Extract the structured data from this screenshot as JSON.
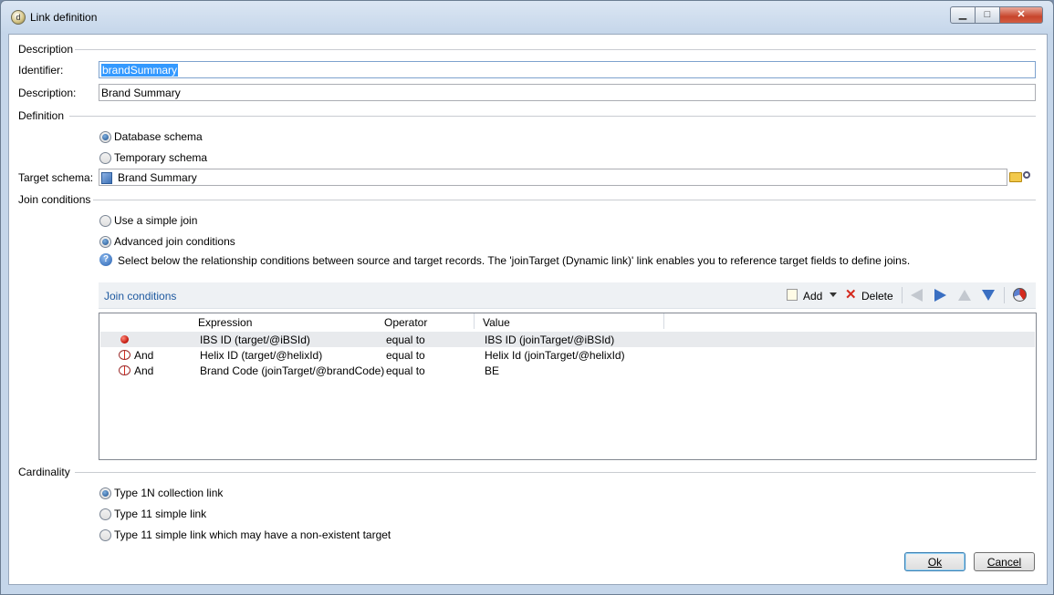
{
  "window": {
    "title": "Link definition",
    "min": "▁",
    "max": "□",
    "close": "✕"
  },
  "description_section": {
    "heading": "Description",
    "identifier_label": "Identifier:",
    "identifier_value": "brandSummary",
    "description_label": "Description:",
    "description_value": "Brand Summary"
  },
  "definition_section": {
    "heading": "Definition",
    "options": [
      {
        "label": "Database schema",
        "selected": true
      },
      {
        "label": "Temporary schema",
        "selected": false
      }
    ],
    "target_schema_label": "Target schema:",
    "target_schema_value": "Brand Summary"
  },
  "join_section": {
    "heading": "Join conditions",
    "options": [
      {
        "label": "Use a simple join",
        "selected": false
      },
      {
        "label": "Advanced join conditions",
        "selected": true
      }
    ],
    "help_text": "Select below the relationship conditions between source and target records. The 'joinTarget (Dynamic link)' link enables you to reference target fields to define joins.",
    "toolbar": {
      "title": "Join conditions",
      "add_label": "Add",
      "delete_label": "Delete"
    },
    "columns": [
      "Expression",
      "Operator",
      "Value"
    ],
    "rows": [
      {
        "conj": "",
        "expression": "IBS ID (target/@iBSId)",
        "operator": "equal to",
        "value": "IBS ID (joinTarget/@iBSId)"
      },
      {
        "conj": "And",
        "expression": "Helix ID (target/@helixId)",
        "operator": "equal to",
        "value": "Helix Id (joinTarget/@helixId)"
      },
      {
        "conj": "And",
        "expression": "Brand Code (joinTarget/@brandCode)",
        "operator": "equal to",
        "value": "BE"
      }
    ]
  },
  "cardinality_section": {
    "heading": "Cardinality",
    "options": [
      {
        "label": "Type 1N collection link",
        "selected": true
      },
      {
        "label": "Type 11 simple link",
        "selected": false
      },
      {
        "label": "Type 11 simple link which may have a non-existent target",
        "selected": false
      }
    ]
  },
  "buttons": {
    "ok": "Ok",
    "cancel": "Cancel"
  },
  "colors": {
    "accent": "#1f5aa0",
    "selection": "#3399ff",
    "delete": "#d42a1e"
  }
}
